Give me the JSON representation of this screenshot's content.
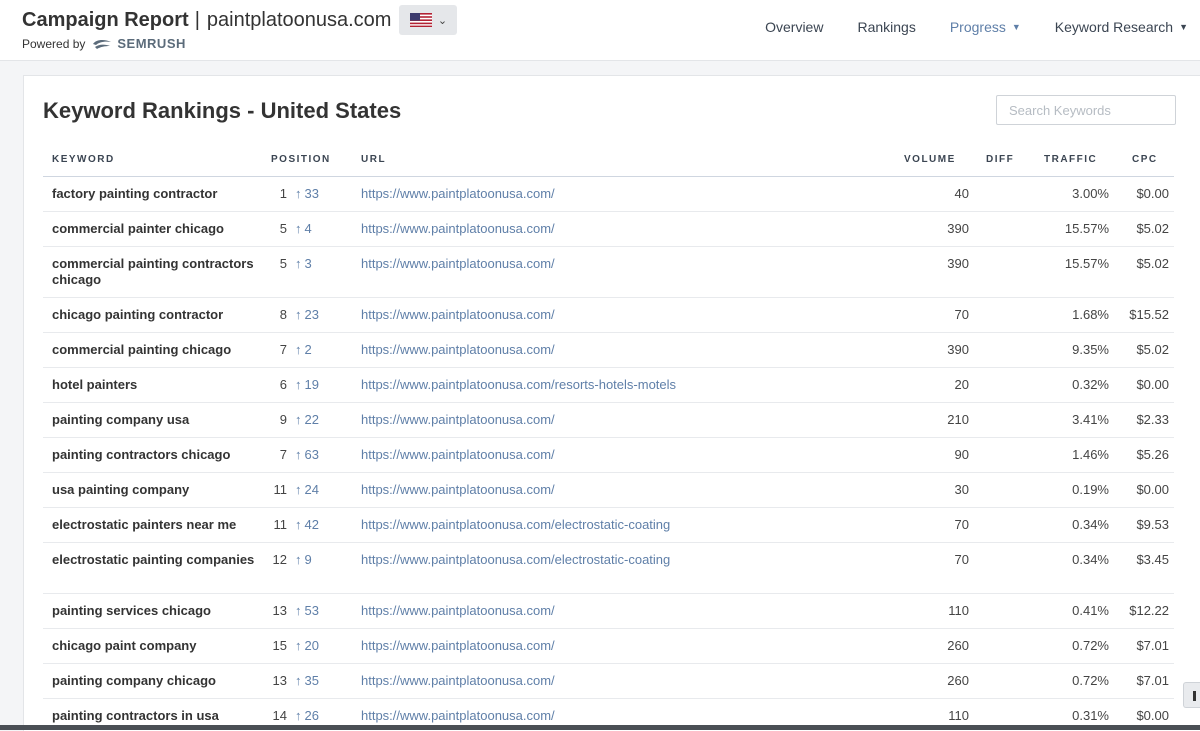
{
  "header": {
    "report_title": "Campaign Report",
    "separator": "|",
    "domain": "paintplatoonusa.com",
    "powered_by": "Powered by",
    "brand": "SEMRUSH",
    "country_flag_icon": "us-flag-icon",
    "nav": [
      {
        "label": "Overview",
        "active": false,
        "dropdown": false
      },
      {
        "label": "Rankings",
        "active": false,
        "dropdown": false
      },
      {
        "label": "Progress",
        "active": true,
        "dropdown": true
      },
      {
        "label": "Keyword Research",
        "active": false,
        "dropdown": true
      }
    ]
  },
  "main": {
    "title": "Keyword Rankings - United States",
    "search_placeholder": "Search Keywords",
    "columns": {
      "keyword": "KEYWORD",
      "position": "POSITION",
      "url": "URL",
      "volume": "VOLUME",
      "diff": "DIFF",
      "traffic": "TRAFFIC",
      "cpc": "CPC"
    },
    "rows": [
      {
        "keyword": "factory painting contractor",
        "position": "1",
        "change": "33",
        "url": "https://www.paintplatoonusa.com/",
        "volume": "40",
        "diff": "",
        "traffic": "3.00%",
        "cpc": "$0.00",
        "tall": false
      },
      {
        "keyword": "commercial painter chicago",
        "position": "5",
        "change": "4",
        "url": "https://www.paintplatoonusa.com/",
        "volume": "390",
        "diff": "",
        "traffic": "15.57%",
        "cpc": "$5.02",
        "tall": false
      },
      {
        "keyword": "commercial painting contractors chicago",
        "position": "5",
        "change": "3",
        "url": "https://www.paintplatoonusa.com/",
        "volume": "390",
        "diff": "",
        "traffic": "15.57%",
        "cpc": "$5.02",
        "tall": true
      },
      {
        "keyword": "chicago painting contractor",
        "position": "8",
        "change": "23",
        "url": "https://www.paintplatoonusa.com/",
        "volume": "70",
        "diff": "",
        "traffic": "1.68%",
        "cpc": "$15.52",
        "tall": false
      },
      {
        "keyword": "commercial painting chicago",
        "position": "7",
        "change": "2",
        "url": "https://www.paintplatoonusa.com/",
        "volume": "390",
        "diff": "",
        "traffic": "9.35%",
        "cpc": "$5.02",
        "tall": false
      },
      {
        "keyword": "hotel painters",
        "position": "6",
        "change": "19",
        "url": "https://www.paintplatoonusa.com/resorts-hotels-motels",
        "volume": "20",
        "diff": "",
        "traffic": "0.32%",
        "cpc": "$0.00",
        "tall": false
      },
      {
        "keyword": "painting company usa",
        "position": "9",
        "change": "22",
        "url": "https://www.paintplatoonusa.com/",
        "volume": "210",
        "diff": "",
        "traffic": "3.41%",
        "cpc": "$2.33",
        "tall": false
      },
      {
        "keyword": "painting contractors chicago",
        "position": "7",
        "change": "63",
        "url": "https://www.paintplatoonusa.com/",
        "volume": "90",
        "diff": "",
        "traffic": "1.46%",
        "cpc": "$5.26",
        "tall": false
      },
      {
        "keyword": "usa painting company",
        "position": "11",
        "change": "24",
        "url": "https://www.paintplatoonusa.com/",
        "volume": "30",
        "diff": "",
        "traffic": "0.19%",
        "cpc": "$0.00",
        "tall": false
      },
      {
        "keyword": "electrostatic painters near me",
        "position": "11",
        "change": "42",
        "url": "https://www.paintplatoonusa.com/electrostatic-coating",
        "volume": "70",
        "diff": "",
        "traffic": "0.34%",
        "cpc": "$9.53",
        "tall": false
      },
      {
        "keyword": "electrostatic painting companies",
        "position": "12",
        "change": "9",
        "url": "https://www.paintplatoonusa.com/electrostatic-coating",
        "volume": "70",
        "diff": "",
        "traffic": "0.34%",
        "cpc": "$3.45",
        "tall": true
      },
      {
        "keyword": "painting services chicago",
        "position": "13",
        "change": "53",
        "url": "https://www.paintplatoonusa.com/",
        "volume": "110",
        "diff": "",
        "traffic": "0.41%",
        "cpc": "$12.22",
        "tall": false
      },
      {
        "keyword": "chicago paint company",
        "position": "15",
        "change": "20",
        "url": "https://www.paintplatoonusa.com/",
        "volume": "260",
        "diff": "",
        "traffic": "0.72%",
        "cpc": "$7.01",
        "tall": false
      },
      {
        "keyword": "painting company chicago",
        "position": "13",
        "change": "35",
        "url": "https://www.paintplatoonusa.com/",
        "volume": "260",
        "diff": "",
        "traffic": "0.72%",
        "cpc": "$7.01",
        "tall": false
      },
      {
        "keyword": "painting contractors in usa",
        "position": "14",
        "change": "26",
        "url": "https://www.paintplatoonusa.com/",
        "volume": "110",
        "diff": "",
        "traffic": "0.31%",
        "cpc": "$0.00",
        "tall": false
      }
    ]
  },
  "colors": {
    "accent": "#5f7fa8",
    "text": "#333333",
    "background": "#f4f5f7"
  }
}
